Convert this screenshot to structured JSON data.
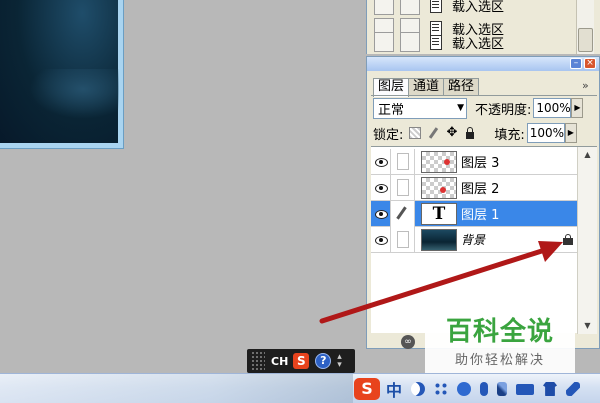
{
  "actions_panel": {
    "items": [
      {
        "label": "载入选区"
      },
      {
        "label": "载入选区"
      },
      {
        "label": "载入选区"
      }
    ]
  },
  "layers_panel": {
    "tabs": [
      {
        "label": "图层",
        "active": true
      },
      {
        "label": "通道",
        "active": false
      },
      {
        "label": "路径",
        "active": false
      }
    ],
    "more_glyph": "»",
    "blend_mode": "正常",
    "opacity_label": "不透明度:",
    "opacity_value": "100%",
    "lock_label": "锁定:",
    "fill_label": "填充:",
    "fill_value": "100%",
    "layers": [
      {
        "name": "图层 3",
        "thumbnail": "transparent-checker",
        "selected": false
      },
      {
        "name": "图层 2",
        "thumbnail": "transparent-checker",
        "selected": false
      },
      {
        "name": "图层 1",
        "thumbnail": "text-layer",
        "thumb_text": "T",
        "selected": true
      },
      {
        "name": "背景",
        "thumbnail": "photo",
        "selected": false,
        "locked": true
      }
    ]
  },
  "watermark": {
    "title": "百科全说",
    "subtitle": "助你轻松解决"
  },
  "ime_bar": {
    "lang": "CH",
    "brand_glyph": "S",
    "help_glyph": "?"
  },
  "tray": {
    "brand_glyph": "S",
    "lang_glyph": "中"
  },
  "colors": {
    "selection": "#3a87e8",
    "annotation_arrow": "#b01818",
    "watermark_green": "#3aa43f"
  }
}
